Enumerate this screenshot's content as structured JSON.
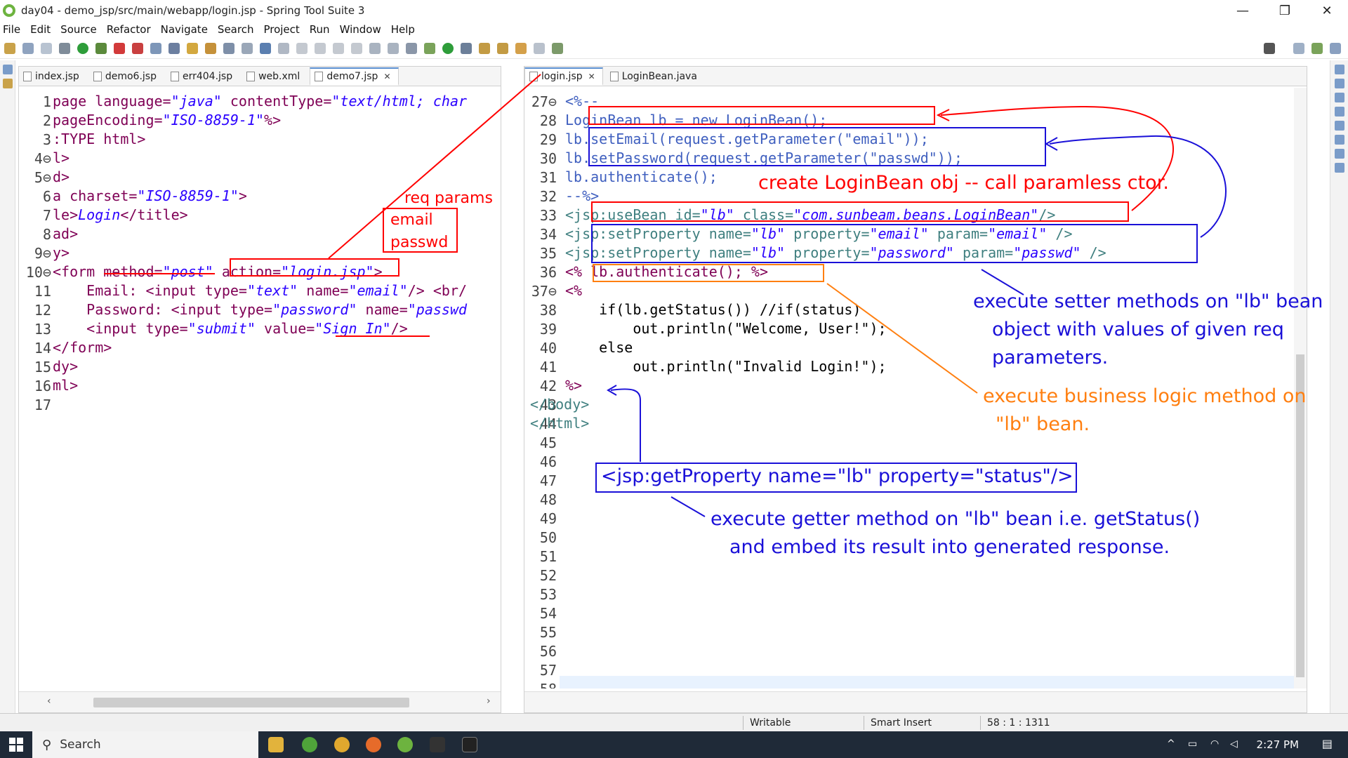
{
  "window": {
    "title": "day04 - demo_jsp/src/main/webapp/login.jsp - Spring Tool Suite 3",
    "controls": [
      "—",
      "❐",
      "✕"
    ]
  },
  "menu": [
    "File",
    "Edit",
    "Source",
    "Refactor",
    "Navigate",
    "Search",
    "Project",
    "Run",
    "Window",
    "Help"
  ],
  "left_editor": {
    "tabs": [
      "index.jsp",
      "demo6.jsp",
      "err404.jsp",
      "web.xml",
      "demo7.jsp"
    ],
    "active_tab": "demo7.jsp",
    "line_numbers": [
      "1",
      "2",
      "3",
      "4⊖",
      "5⊖",
      "6",
      "7",
      "8",
      "9⊖",
      "10⊖",
      "11",
      "12",
      "13",
      "14",
      "15",
      "16",
      "17"
    ],
    "lines": [
      [
        "page language=",
        "\"java\"",
        " contentType=",
        "\"text/html; char"
      ],
      [
        "pageEncoding=",
        "\"ISO-8859-1\"",
        "%>",
        ""
      ],
      [
        ":TYPE html>",
        "",
        "",
        ""
      ],
      [
        "l>",
        "",
        "",
        ""
      ],
      [
        "d>",
        "",
        "",
        ""
      ],
      [
        "a charset=",
        "\"ISO-8859-1\"",
        ">",
        ""
      ],
      [
        "le>",
        "Login",
        "</title>",
        ""
      ],
      [
        "ad>",
        "",
        "",
        ""
      ],
      [
        "y>",
        "",
        "",
        ""
      ],
      [
        "<form method=",
        "\"post\"",
        " action=",
        "\"login.jsp\"",
        ">"
      ],
      [
        "    Email: <input type=",
        "\"text\"",
        " name=",
        "\"email\"",
        "/> <br/"
      ],
      [
        "    Password: <input type=",
        "\"password\"",
        " name=",
        "\"passwd"
      ],
      [
        "    <input type=",
        "\"submit\"",
        " value=",
        "\"Sign In\"",
        "/>"
      ],
      [
        "</form>",
        "",
        "",
        ""
      ],
      [
        "dy>",
        "",
        "",
        ""
      ],
      [
        "ml>",
        "",
        "",
        ""
      ],
      [
        "",
        "",
        "",
        ""
      ]
    ]
  },
  "right_editor": {
    "tabs": [
      "login.jsp",
      "LoginBean.java"
    ],
    "active_tab": "login.jsp",
    "line_numbers": [
      "27⊖",
      "28",
      "29",
      "30",
      "31",
      "32",
      "33",
      "34",
      "35",
      "36",
      "37⊖",
      "38",
      "39",
      "40",
      "41",
      "42",
      "43",
      "44",
      "45",
      "46",
      "47",
      "48",
      "49",
      "50",
      "51",
      "52",
      "53",
      "54",
      "55",
      "56",
      "57",
      "58"
    ],
    "lines": [
      "<%--",
      "LoginBean lb = new LoginBean();",
      "lb.setEmail(request.getParameter(\"email\"));",
      "lb.setPassword(request.getParameter(\"passwd\"));",
      "lb.authenticate();",
      "--%>",
      "<jsp:useBean id=\"lb\" class=\"com.sunbeam.beans.LoginBean\"/>",
      "<jsp:setProperty name=\"lb\" property=\"email\" param=\"email\" />",
      "<jsp:setProperty name=\"lb\" property=\"password\" param=\"passwd\" />",
      "<% lb.authenticate(); %>",
      "<%",
      "    if(lb.getStatus()) //if(status)",
      "        out.println(\"Welcome, User!\");",
      "    else",
      "        out.println(\"Invalid Login!\");",
      "%>",
      "</body>",
      "</html>"
    ]
  },
  "annotations": {
    "req_params": "req params",
    "email": "email",
    "passwd": "passwd",
    "create_bean": "create LoginBean obj -- call paramless ctor.",
    "setter_1": "execute setter methods on \"lb\" bean",
    "setter_2": "object with values of given req",
    "setter_3": "parameters.",
    "business_1": "execute business logic method on",
    "business_2": "\"lb\" bean.",
    "getproperty": "<jsp:getProperty name=\"lb\" property=\"status\"/>",
    "getter_1": "execute getter method on \"lb\" bean i.e. getStatus()",
    "getter_2": "and embed its result into generated response."
  },
  "status_bar": {
    "mode": "Writable",
    "insert": "Smart Insert",
    "position": "58 : 1 : 1311"
  },
  "taskbar": {
    "search_label": "Search",
    "time": "2:27 PM"
  },
  "colors": {
    "annotation_red": "#ff0000",
    "annotation_blue": "#1a10d8",
    "annotation_orange": "#ff7f10"
  }
}
